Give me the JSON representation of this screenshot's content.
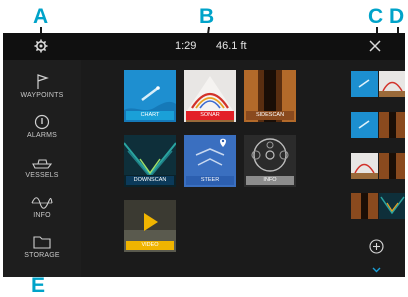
{
  "callouts": [
    "A",
    "B",
    "C",
    "D",
    "E"
  ],
  "topbar": {
    "time": "1:29",
    "depth": "46.1 ft",
    "settings_icon": "gear-icon",
    "close_icon": "close-icon"
  },
  "sidebar": {
    "items": [
      {
        "label": "WAYPOINTS",
        "icon": "flag-icon"
      },
      {
        "label": "ALARMS",
        "icon": "alarm-icon"
      },
      {
        "label": "VESSELS",
        "icon": "vessel-icon"
      },
      {
        "label": "INFO",
        "icon": "signal-icon"
      },
      {
        "label": "STORAGE",
        "icon": "folder-icon"
      }
    ]
  },
  "apps": [
    {
      "label": "CHART",
      "label_color": "#1aa0d8"
    },
    {
      "label": "SONAR",
      "label_color": "#e32027"
    },
    {
      "label": "SIDESCAN",
      "label_color": "#8a4a1e"
    },
    {
      "label": "DOWNSCAN",
      "label_color": "#0b3a5a"
    },
    {
      "label": "STEER",
      "label_color": "#2c5fb0"
    },
    {
      "label": "INFO",
      "label_color": "#8c8c8c"
    },
    {
      "label": "VIDEO",
      "label_color": "#f0b400"
    }
  ],
  "favorites": {
    "add_icon": "add-icon",
    "more_icon": "chevron-down-icon"
  }
}
